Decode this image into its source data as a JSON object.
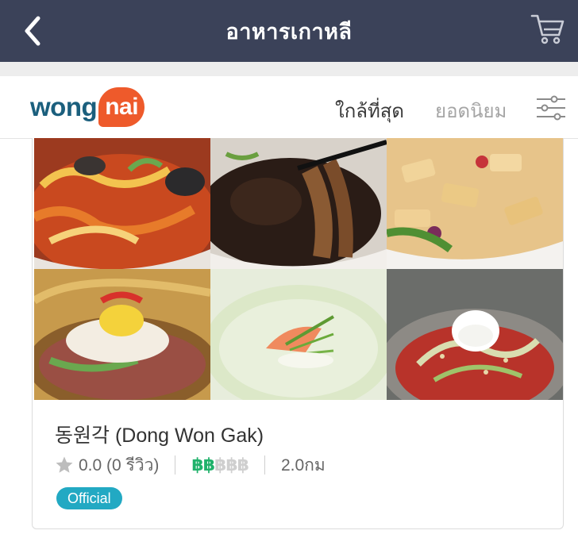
{
  "nav": {
    "title": "อาหารเกาหลี",
    "back_icon": "chevron-left-icon",
    "cart_icon": "cart-icon",
    "background": "#3b4259"
  },
  "brand": {
    "logo_left": "wong",
    "logo_right": "nai",
    "logo_color": "#1b5f7d",
    "logo_accent": "#ee5a2b"
  },
  "tabs": [
    {
      "label": "ใกล้ที่สุด",
      "active": true
    },
    {
      "label": "ยอดนิยม",
      "active": false
    }
  ],
  "filter_icon": "sliders-icon",
  "restaurant": {
    "name": "동원각 (Dong Won Gak)",
    "rating": "0.0 (0 รีวิว)",
    "price_symbols": {
      "active": "฿฿",
      "inactive": "฿฿฿"
    },
    "price_level": 2,
    "price_max": 5,
    "distance": "2.0กม",
    "badge": "Official",
    "badge_color": "#22a9c3",
    "price_color": "#20b26b",
    "photos": [
      "jjamppong-seafood-noodle",
      "jajangmyeon-black-bean-noodle",
      "tangsuyuk-sweet-sour-pork",
      "naengmyeon-cold-noodle",
      "kongguksu-soy-milk-noodle",
      "bibim-naengmyeon-spicy-noodle"
    ]
  }
}
